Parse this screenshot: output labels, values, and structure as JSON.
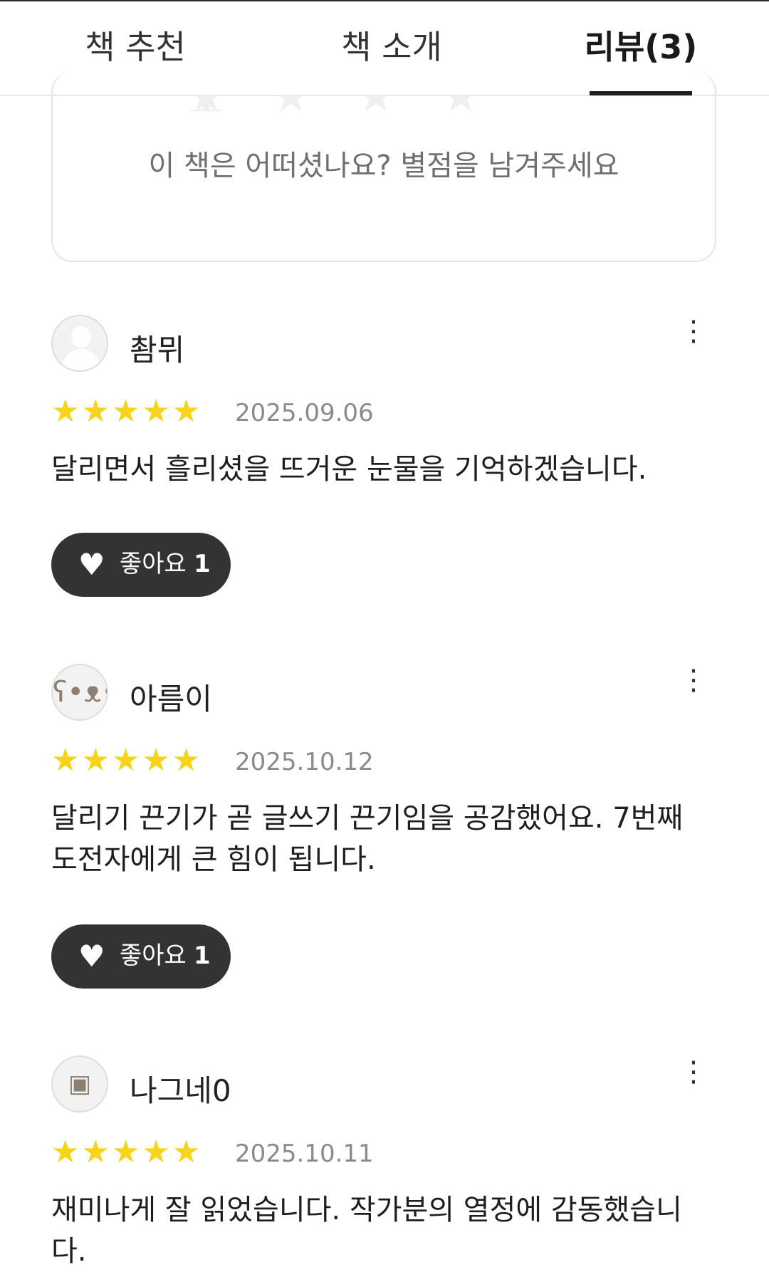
{
  "tabs": [
    {
      "label": "책 추천"
    },
    {
      "label": "책 소개"
    },
    {
      "label": "리뷰(3)"
    }
  ],
  "rating_prompt": "이 책은 어떠셨나요? 별점을 남겨주세요",
  "reviews": [
    {
      "user": "촴뮈",
      "stars": "★★★★★",
      "rating": 5,
      "date": "2025.09.06",
      "text": "달리면서 흘리셨을 뜨거운 눈물을 기억하겠습니다.",
      "like_label": "좋아요",
      "like_count": "1"
    },
    {
      "user": "아름이",
      "stars": "★★★★★",
      "rating": 5,
      "date": "2025.10.12",
      "text": "달리기 끈기가 곧 글쓰기 끈기임을 공감했어요. 7번째 도전자에게 큰 힘이 됩니다.",
      "like_label": "좋아요",
      "like_count": "1"
    },
    {
      "user": "나그네0",
      "stars": "★★★★★",
      "rating": 5,
      "date": "2025.10.11",
      "text": "재미나게 잘 읽었습니다. 작가분의 열정에 감동했습니다."
    }
  ],
  "icons": {
    "more": "more-vertical-icon",
    "heart": "heart-icon",
    "star": "star-icon"
  },
  "colors": {
    "star": "#f8d31c",
    "like_button": "#333333",
    "tab_active_underline": "#1f1f1f"
  }
}
